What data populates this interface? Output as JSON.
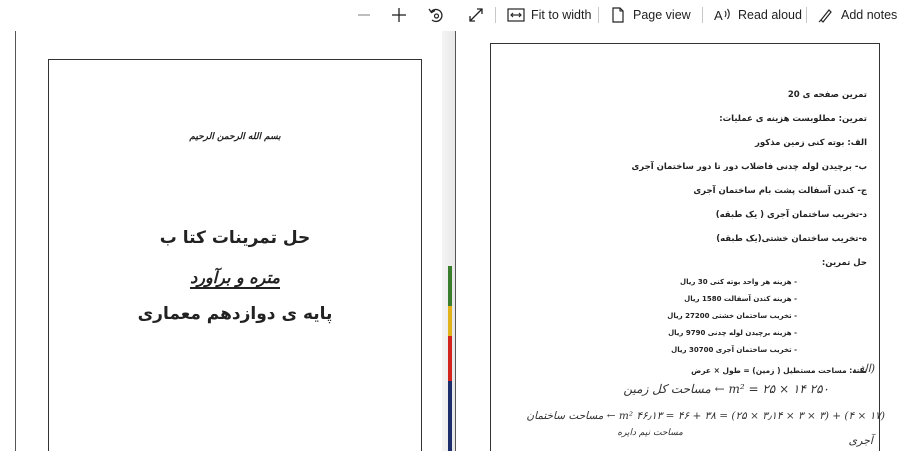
{
  "toolbar": {
    "zoom_out_label": "—",
    "zoom_in_label": "+",
    "fit_to_width": "Fit to width",
    "page_view": "Page view",
    "read_aloud": "Read aloud",
    "add_notes": "Add notes"
  },
  "left_page": {
    "bismillah": "بسم الله الرحمن الرحیم",
    "title_1": "حل تمرینات کتا ب",
    "title_2": "متره و برآورد",
    "title_3": "پایه ی دوازدهم معماری"
  },
  "right_page": {
    "lines": [
      "تمرین صفحه ی 20",
      "تمرین: مطلوبست هزینه ی عملیات:",
      "الف: بوته کنی زمین مذکور",
      "ب- برچیدن لوله چدنی فاضلاب دور تا دور ساختمان آجری",
      "ج- کندن آسفالت پشت بام ساختمان آجری",
      "د-تخریب ساختمان آجری ( یک طبقه)",
      "ه-تخریب ساختمان خشتی(یک طبقه)",
      "حل تمرین:"
    ],
    "items": [
      "- هزینه هر واحد بوته کنی 30 ریال",
      "- هزینه کندن آسفالت 1580 ریال",
      "- تخریب ساختمان خشتی 27200 ریال",
      "- هزینه برچیدن لوله چدنی 9790 ریال",
      "- تخریب ساختمان آجری 30700 ریال"
    ],
    "note": "نکته: مساحت مستطیل ( زمین) = طول × عرض",
    "hand_1": "(الف",
    "hand_2": "۲۵۰ m² = ۲۵ × ۱۴ ← مساحت کل زمین",
    "hand_3": "(۱۷ × ۴) + (۳ × ۳ × ۳٫۱۴ × ۲۵) = ۳۸ + ۴۶ = ۴۶٫۱۳ m² ← مساحت ساختمان",
    "hand_4": "مساحت نیم دایره",
    "hand_5": "آجری"
  }
}
